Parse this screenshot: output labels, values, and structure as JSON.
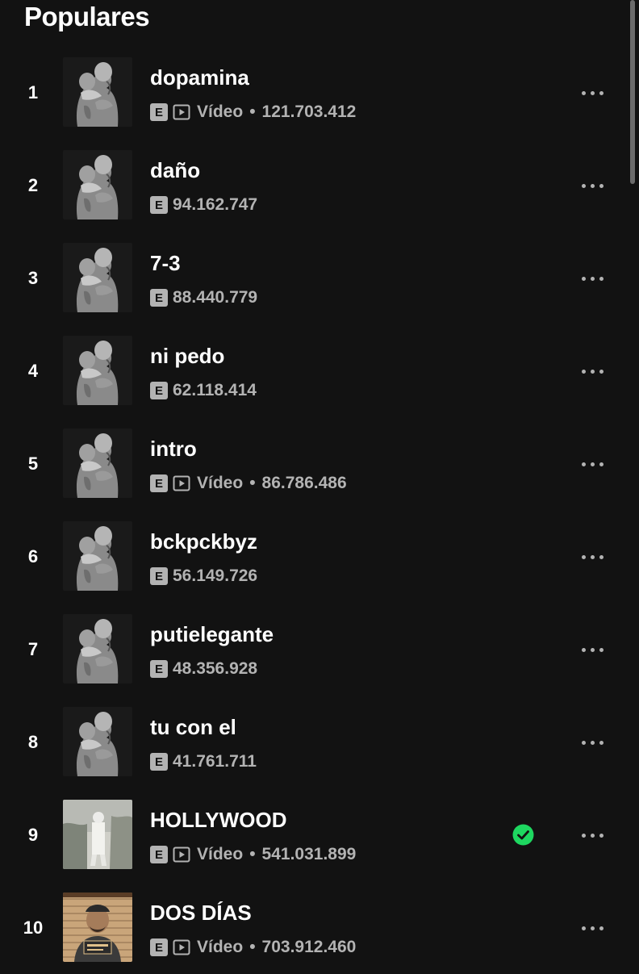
{
  "section": {
    "title": "Populares"
  },
  "labels": {
    "explicit": "E",
    "video": "Vídeo",
    "separator": "•"
  },
  "colors": {
    "background": "#121212",
    "text": "#ffffff",
    "subtext": "#b3b3b3",
    "accent": "#1ed760"
  },
  "tracks": [
    {
      "number": "1",
      "title": "dopamina",
      "plays": "121.703.412",
      "explicit": true,
      "video": true,
      "saved": false,
      "cover": "statue-cover"
    },
    {
      "number": "2",
      "title": "daño",
      "plays": "94.162.747",
      "explicit": true,
      "video": false,
      "saved": false,
      "cover": "statue-cover"
    },
    {
      "number": "3",
      "title": "7-3",
      "plays": "88.440.779",
      "explicit": true,
      "video": false,
      "saved": false,
      "cover": "statue-cover"
    },
    {
      "number": "4",
      "title": "ni pedo",
      "plays": "62.118.414",
      "explicit": true,
      "video": false,
      "saved": false,
      "cover": "statue-cover"
    },
    {
      "number": "5",
      "title": "intro",
      "plays": "86.786.486",
      "explicit": true,
      "video": true,
      "saved": false,
      "cover": "statue-cover"
    },
    {
      "number": "6",
      "title": "bckpckbyz",
      "plays": "56.149.726",
      "explicit": true,
      "video": false,
      "saved": false,
      "cover": "statue-cover"
    },
    {
      "number": "7",
      "title": "putielegante",
      "plays": "48.356.928",
      "explicit": true,
      "video": false,
      "saved": false,
      "cover": "statue-cover"
    },
    {
      "number": "8",
      "title": "tu con el",
      "plays": "41.761.711",
      "explicit": true,
      "video": false,
      "saved": false,
      "cover": "statue-cover"
    },
    {
      "number": "9",
      "title": "HOLLYWOOD",
      "plays": "541.031.899",
      "explicit": true,
      "video": true,
      "saved": true,
      "cover": "photo-cover"
    },
    {
      "number": "10",
      "title": "DOS DÍAS",
      "plays": "703.912.460",
      "explicit": true,
      "video": true,
      "saved": false,
      "cover": "mugshot-cover"
    }
  ]
}
